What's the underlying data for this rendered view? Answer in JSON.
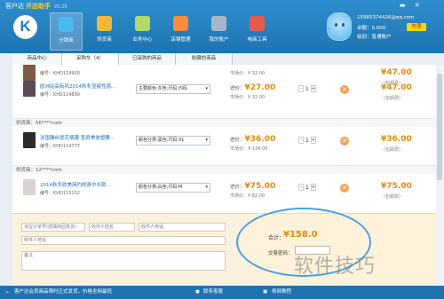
{
  "app": {
    "title": "客户达",
    "subtitle": "开店助手",
    "version": "V1.25",
    "logo_letter": "K"
  },
  "window_buttons": [
    "▬",
    "✕"
  ],
  "nav": [
    {
      "label": "分销商",
      "icon": "shop-icon",
      "color": "#4cb8f2",
      "active": true
    },
    {
      "label": "供货商",
      "icon": "box-icon",
      "color": "#f5b73b",
      "active": false
    },
    {
      "label": "业务中心",
      "icon": "briefcase-icon",
      "color": "#b2d965",
      "active": false
    },
    {
      "label": "店铺管理",
      "icon": "store-icon",
      "color": "#ff8c3a",
      "active": false
    },
    {
      "label": "我的账户",
      "icon": "account-icon",
      "color": "#a7b6c6",
      "active": false
    },
    {
      "label": "电商工具",
      "icon": "tools-icon",
      "color": "#e55a4d",
      "active": false
    }
  ],
  "user": {
    "phone": "15965374426@qq.com",
    "cash": "余额：0.000",
    "recharge": "充值",
    "level": "级别：普通账户"
  },
  "tabs": [
    "商品中心",
    "采购车（4）",
    "已采购的商品",
    "收藏的商品"
  ],
  "items": [
    {
      "title": "",
      "code": "编号：KHD114900",
      "spec": "",
      "price_label": "",
      "price": "",
      "market": "市场价：¥ 32.00",
      "qty": "",
      "total": "¥47.00",
      "shipped": "(包邮费)",
      "thumb": "#7b5a46"
    },
    {
      "title": "欧洲站高街风2014秋冬显瘦性感…",
      "code": "编号：KHD114899",
      "spec": "主要颜色:灰色;尺码:均码",
      "price_label": "进价：",
      "price": "¥27.00",
      "market": "市场价：¥ 32.00",
      "qty": "1",
      "total": "¥47.00",
      "shipped": "(包邮费)",
      "thumb": "#5c4a58"
    },
    {
      "title": "法国雕丝提花情趣 宽肩美体塑腰…",
      "code": "编号：KHD114777",
      "spec": "颜色分类:黑色;尺码:XL",
      "price_label": "进价：",
      "price": "¥36.00",
      "market": "市场价：¥ 134.00",
      "qty": "1",
      "total": "¥36.00",
      "shipped": "(包邮费)",
      "thumb": "#2b2b2b"
    },
    {
      "title": "2014秋冬欧美简约修身中长款…",
      "code": "编号：KHD115152",
      "spec": "颜色分类:白色;尺码:M",
      "price_label": "进价：",
      "price": "¥75.00",
      "market": "市场价：¥ 82.00",
      "qty": "1",
      "total": "¥75.00",
      "shipped": "(包邮费)",
      "thumb": "#d9d2cf"
    }
  ],
  "suppliers": [
    "供货商：56****com",
    "供货商：12****com"
  ],
  "order_form": {
    "order_no": "淘宝订单号(选填商回发货)",
    "receiver_name": "收件人姓名",
    "receiver_phone": "收件人电话",
    "receiver_address": "收件人地址",
    "note": "备注"
  },
  "summary": {
    "total_label": "合计：",
    "total_value": "¥158.0",
    "password_label": "交易密码："
  },
  "watermark": "软件技巧",
  "status": {
    "notice": "客户达会员商品限时正式发货，价格全网最低",
    "service": "联系客服",
    "video": "视频教程"
  }
}
